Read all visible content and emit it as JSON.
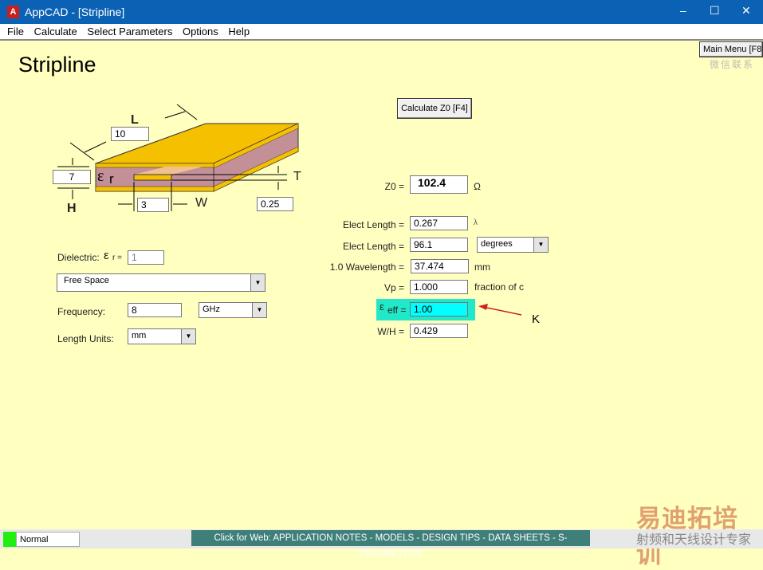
{
  "window": {
    "title": "AppCAD - [Stripline]",
    "app_icon": "appcad-icon",
    "min": "–",
    "max": "☐",
    "close": "✕"
  },
  "menu": [
    "File",
    "Calculate",
    "Select Parameters",
    "Options",
    "Help"
  ],
  "page_title": "Stripline",
  "main_menu_button": "Main Menu [F8",
  "diagram": {
    "L_label": "L",
    "L_value": "10",
    "H_label": "H",
    "H_value": "7",
    "W_label": "W",
    "W_value": "3",
    "T_label": "T",
    "T_value": "0.25",
    "er_label": "εr"
  },
  "inputs": {
    "dielectric_label": "Dielectric:",
    "er_symbol": "ε",
    "er_sub": "r =",
    "er_value": "1",
    "material": "Free Space",
    "frequency_label": "Frequency:",
    "frequency_value": "8",
    "frequency_unit": "GHz",
    "length_units_label": "Length Units:",
    "length_units": "mm"
  },
  "calculate_button": "Calculate Z0  [F4]",
  "results": {
    "z0_label": "Z0 =",
    "z0_value": "102.4",
    "z0_unit": "Ω",
    "elen1_label": "Elect Length =",
    "elen1_value": "0.267",
    "elen1_unit": "λ",
    "elen2_label": "Elect Length =",
    "elen2_value": "96.1",
    "elen2_unit": "degrees",
    "wl_label": "1.0 Wavelength =",
    "wl_value": "37.474",
    "wl_unit": "mm",
    "vp_label": "Vp =",
    "vp_value": "1.000",
    "vp_unit": "fraction of c",
    "eeff_symbol": "ε",
    "eeff_label": "eff =",
    "eeff_value": "1.00",
    "wh_label": "W/H =",
    "wh_value": "0.429"
  },
  "annotation": "K",
  "status": {
    "mode": "Normal",
    "web_link": "Click for Web: APPLICATION NOTES - MODELS - DESIGN TIPS - DATA SHEETS - S-PARAMETERS"
  },
  "watermark": {
    "top": "微信联系",
    "brand": "易迪拓培训",
    "tagline": "射频和天线设计专家"
  },
  "colors": {
    "title": "#0b62b4",
    "bg": "#ffffc0",
    "highlight": "#20e8c8",
    "eeff_field": "#00ffff",
    "status_link": "#3f7f7a"
  }
}
